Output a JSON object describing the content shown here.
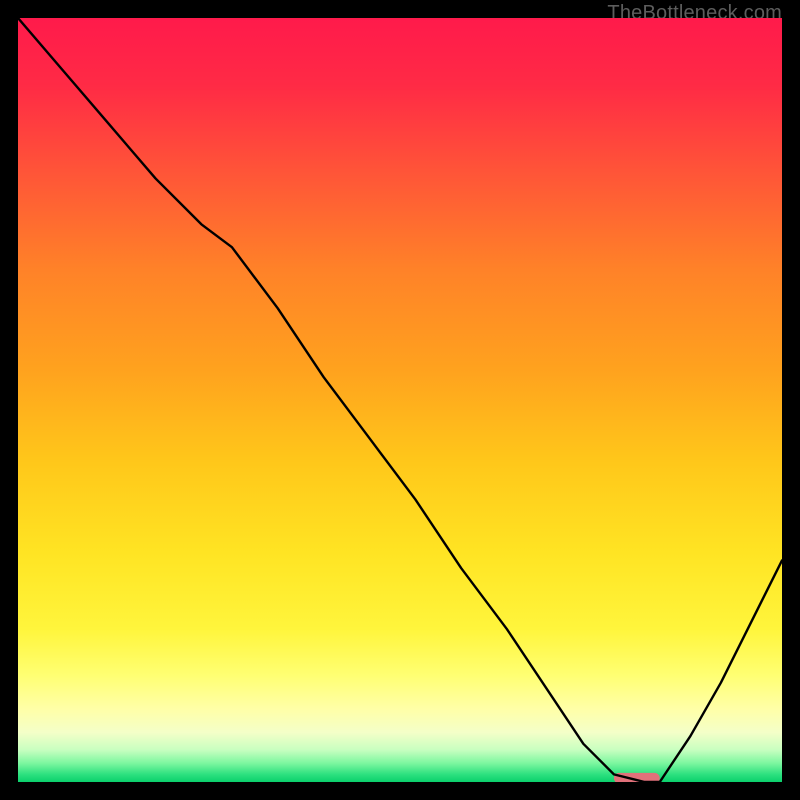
{
  "watermark": "TheBottleneck.com",
  "chart_data": {
    "type": "line",
    "title": "",
    "xlabel": "",
    "ylabel": "",
    "xlim": [
      0,
      100
    ],
    "ylim": [
      0,
      100
    ],
    "grid": false,
    "legend": false,
    "background": {
      "type": "vertical-gradient",
      "stops": [
        {
          "offset": 0.0,
          "color": "#ff1a4b"
        },
        {
          "offset": 0.09,
          "color": "#ff2b45"
        },
        {
          "offset": 0.2,
          "color": "#ff5438"
        },
        {
          "offset": 0.33,
          "color": "#ff8228"
        },
        {
          "offset": 0.46,
          "color": "#ffa21e"
        },
        {
          "offset": 0.58,
          "color": "#ffc71a"
        },
        {
          "offset": 0.7,
          "color": "#ffe423"
        },
        {
          "offset": 0.8,
          "color": "#fff53c"
        },
        {
          "offset": 0.86,
          "color": "#ffff72"
        },
        {
          "offset": 0.905,
          "color": "#ffffa8"
        },
        {
          "offset": 0.935,
          "color": "#f4ffc8"
        },
        {
          "offset": 0.958,
          "color": "#c8ffc0"
        },
        {
          "offset": 0.975,
          "color": "#7ef7a0"
        },
        {
          "offset": 0.99,
          "color": "#2de17f"
        },
        {
          "offset": 1.0,
          "color": "#0bd06c"
        }
      ]
    },
    "series": [
      {
        "name": "bottleneck-curve",
        "type": "line",
        "color": "#000000",
        "x": [
          0,
          6,
          12,
          18,
          24,
          28,
          34,
          40,
          46,
          52,
          58,
          64,
          70,
          74,
          78,
          82,
          84,
          88,
          92,
          96,
          100
        ],
        "y": [
          100,
          93,
          86,
          79,
          73,
          70,
          62,
          53,
          45,
          37,
          28,
          20,
          11,
          5,
          1,
          0,
          0,
          6,
          13,
          21,
          29
        ]
      }
    ],
    "marker": {
      "name": "optimal-range-marker",
      "color": "#e0717a",
      "x_start": 78,
      "x_end": 84,
      "y": 0.5,
      "thickness_pct": 1.4
    }
  }
}
